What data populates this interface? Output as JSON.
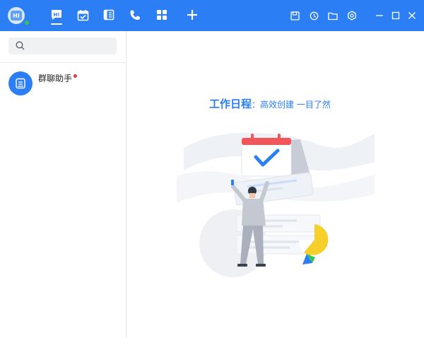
{
  "window": {
    "avatar_text": "HI"
  },
  "topbar": {
    "nav": [
      {
        "name": "messages-icon",
        "label": "HI"
      },
      {
        "name": "calendar-icon"
      },
      {
        "name": "notes-icon"
      },
      {
        "name": "phone-icon"
      },
      {
        "name": "apps-icon"
      },
      {
        "name": "add-icon"
      }
    ],
    "tools": [
      "save-icon",
      "history-icon",
      "folder-icon",
      "settings-icon"
    ],
    "window_controls": [
      "minimize-icon",
      "maximize-icon",
      "close-icon"
    ]
  },
  "sidebar": {
    "search": {
      "placeholder": "",
      "value": ""
    },
    "conversations": [
      {
        "name": "群聊助手",
        "unread": true
      }
    ]
  },
  "main": {
    "headline_title": "工作日程",
    "headline_colon": "：",
    "headline_subtitle": "高效创建 一目了然"
  },
  "colors": {
    "brand": "#2b7ef4",
    "presence": "#39c15a",
    "unread": "#f0333d",
    "accent_yellow": "#f6cf2a",
    "accent_red": "#f0565a"
  }
}
